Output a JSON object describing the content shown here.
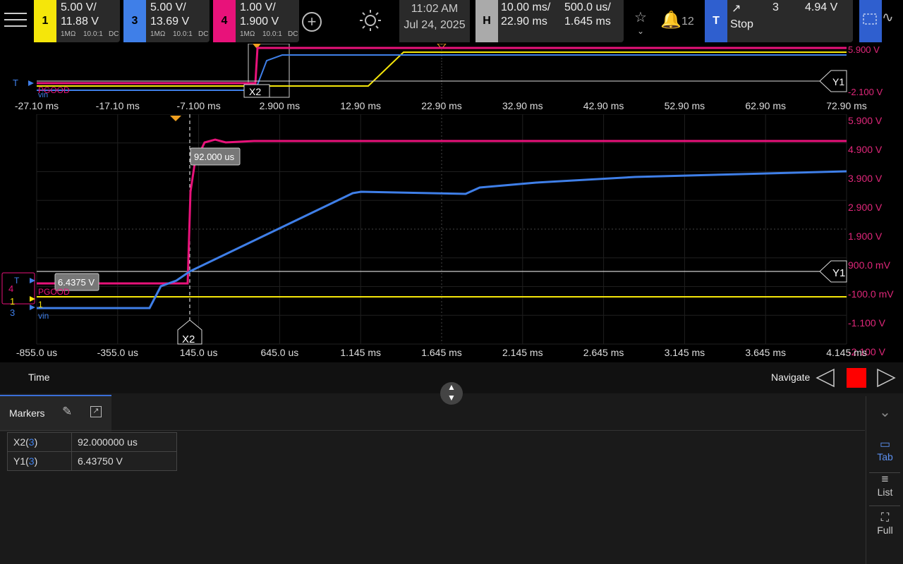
{
  "colors": {
    "ch1": "#f5e60a",
    "ch3": "#3f7fe8",
    "ch4": "#e8127a",
    "trigger": "#2f5fcf"
  },
  "channels": [
    {
      "num": "1",
      "scale": "5.00 V/",
      "offset": "11.88 V",
      "imp": "1MΩ",
      "probe": "10.0:1",
      "coupling": "DC"
    },
    {
      "num": "3",
      "scale": "5.00 V/",
      "offset": "13.69 V",
      "imp": "1MΩ",
      "probe": "10.0:1",
      "coupling": "DC"
    },
    {
      "num": "4",
      "scale": "1.00 V/",
      "offset": "1.900 V",
      "imp": "1MΩ",
      "probe": "10.0:1",
      "coupling": "DC"
    }
  ],
  "clock": {
    "time": "11:02 AM",
    "date": "Jul 24, 2025"
  },
  "horizontal": {
    "label": "H",
    "scale": "10.00 ms/",
    "delay": "22.90 ms",
    "zoom_scale": "500.0 us/",
    "zoom_delay": "1.645 ms"
  },
  "notifications": {
    "count": "12"
  },
  "trigger": {
    "label": "T",
    "channel": "3",
    "level": "4.94 V",
    "state": "Stop"
  },
  "overview": {
    "x_ticks": [
      "-27.10 ms",
      "-17.10 ms",
      "-7.100 ms",
      "2.900 ms",
      "12.90 ms",
      "22.90 ms",
      "32.90 ms",
      "42.90 ms",
      "52.90 ms",
      "62.90 ms",
      "72.90 ms"
    ],
    "right_labels": [
      "5.900 V",
      "-2.100 V"
    ],
    "marker_x": "X2",
    "marker_y": "Y1",
    "trig_label": "T",
    "ch4_label": "PGOOD",
    "ch3_label": "vin"
  },
  "zoom": {
    "x_ticks": [
      "-855.0 us",
      "-355.0 us",
      "145.0 us",
      "645.0 us",
      "1.145 ms",
      "1.645 ms",
      "2.145 ms",
      "2.645 ms",
      "3.145 ms",
      "3.645 ms",
      "4.145 ms"
    ],
    "right_labels": [
      "5.900 V",
      "4.900 V",
      "3.900 V",
      "2.900 V",
      "1.900 V",
      "900.0 mV",
      "-100.0 mV",
      "-1.100 V",
      "-2.100 V"
    ],
    "x_readout": "92.000 us",
    "y_readout": "6.4375 V",
    "marker_x": "X2",
    "marker_y": "Y1",
    "trig_label": "T",
    "ch_labels": {
      "c4": "4",
      "c1": "1",
      "c3": "3",
      "pgood": "PGOOD",
      "one": "1",
      "vin": "vin"
    }
  },
  "timebar": {
    "label": "Time",
    "navigate": "Navigate"
  },
  "markers_panel": {
    "tab_label": "Markers",
    "rows": [
      {
        "name": "X2",
        "src": "3",
        "value": "92.000000 us"
      },
      {
        "name": "Y1",
        "src": "3",
        "value": "6.43750 V"
      }
    ]
  },
  "sidebar": {
    "tab": "Tab",
    "list": "List",
    "full": "Full"
  }
}
